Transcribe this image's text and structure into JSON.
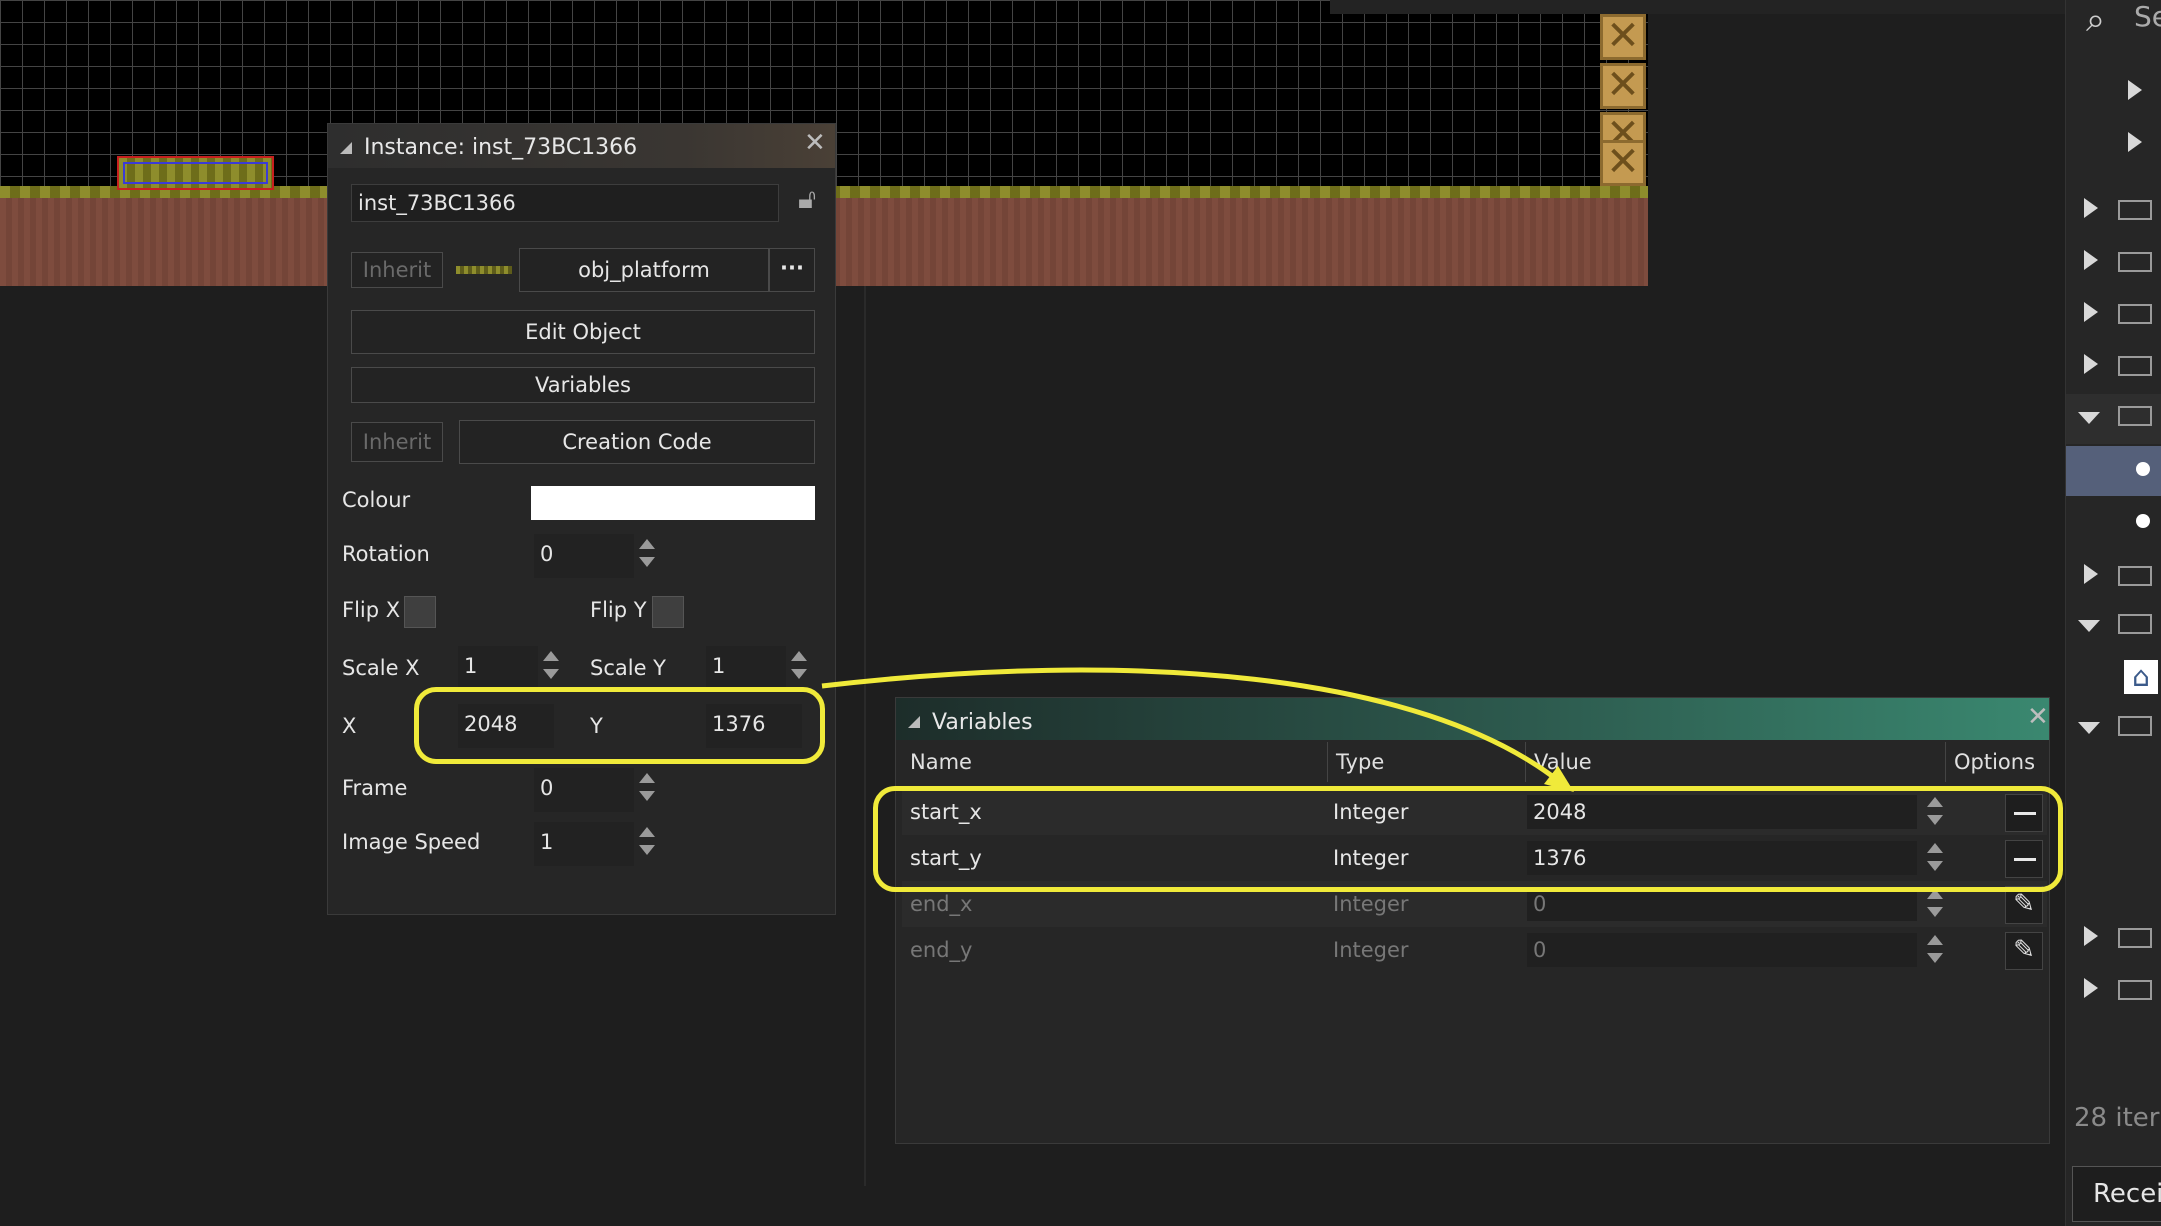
{
  "instance_panel": {
    "title": "Instance: inst_73BC1366",
    "name_value": "inst_73BC1366",
    "inherit_label": "Inherit",
    "object_name": "obj_platform",
    "more_label": "···",
    "edit_object_label": "Edit Object",
    "variables_label": "Variables",
    "creation_code_label": "Creation Code",
    "colour_label": "Colour",
    "colour_value": "#ffffff",
    "rotation_label": "Rotation",
    "rotation_value": "0",
    "flip_x_label": "Flip X",
    "flip_y_label": "Flip Y",
    "scale_x_label": "Scale X",
    "scale_x_value": "1",
    "scale_y_label": "Scale Y",
    "scale_y_value": "1",
    "x_label": "X",
    "x_value": "2048",
    "y_label": "Y",
    "y_value": "1376",
    "frame_label": "Frame",
    "frame_value": "0",
    "image_speed_label": "Image Speed",
    "image_speed_value": "1"
  },
  "variables_panel": {
    "title": "Variables",
    "headers": {
      "name": "Name",
      "type": "Type",
      "value": "Value",
      "options": "Options"
    },
    "rows": [
      {
        "name": "start_x",
        "type": "Integer",
        "value": "2048"
      },
      {
        "name": "start_y",
        "type": "Integer",
        "value": "1376"
      },
      {
        "name": "end_x",
        "type": "Integer",
        "value": "0"
      },
      {
        "name": "end_y",
        "type": "Integer",
        "value": "0"
      }
    ]
  },
  "sidebar": {
    "search_placeholder": "Se",
    "items_count": "28 iter",
    "recent_label": "Recei"
  },
  "colors": {
    "highlight": "#f0ea3a",
    "selection_border": "#c8201e"
  }
}
